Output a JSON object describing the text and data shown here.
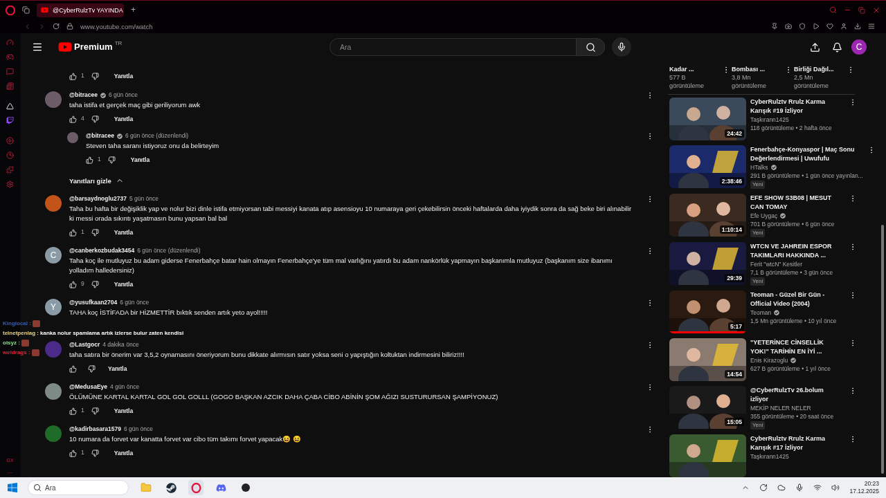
{
  "browser": {
    "tab": {
      "title": "@CyberRulzTv YAYINDA",
      "selected": true
    },
    "new_tab": "+",
    "url": "www.youtube.com/watch"
  },
  "opera_sidebar": {
    "badge": "GX",
    "more": "..."
  },
  "header": {
    "logo_text": "Premium",
    "region": "TR",
    "search": {
      "placeholder": "Ara"
    },
    "avatar": "C"
  },
  "comments": [
    {
      "kind": "actions",
      "likes": "1",
      "reply": "Yanıtla"
    },
    {
      "kind": "comment",
      "avatar": {
        "color": "#6d5c68"
      },
      "author": "@bitracee",
      "verified": true,
      "time": "6 gün önce",
      "text": "taha istifa et gerçek maç gibi geriliyorum awk",
      "likes": "4",
      "reply": "Yanıtla",
      "replies": [
        {
          "avatar": {
            "color": "#6d5c68"
          },
          "author": "@bitracee",
          "verified": true,
          "time": "6 gün önce (düzenlendi)",
          "text": "Steven taha saranı istiyoruz onu da belirteyim",
          "likes": "1",
          "reply": "Yanıtla"
        }
      ],
      "hide_replies": "Yanıtları gizle"
    },
    {
      "kind": "comment",
      "avatar": {
        "color": "#c2541a"
      },
      "author": "@barsaydnoglu2737",
      "verified": false,
      "time": "5 gün önce",
      "text": "Taha bu hafta bir değişiklik yap ve nolur bizi dinle istifa etmiyorsan tabi messiyi kanata atıp asensioyu 10 numaraya geri çekebilirsin önceki haftalarda daha iyiydik sonra da sağ beke biri alınabilir ki messi orada sıkıntı yaşatmasın bunu yapsan bal bal",
      "likes": "1",
      "reply": "Yanıtla"
    },
    {
      "kind": "comment",
      "avatar": {
        "color": "#8a9ba6",
        "letter": "C"
      },
      "author": "@canberkozbudak3454",
      "verified": false,
      "time": "6 gün önce (düzenlendi)",
      "text": "Taha koç ile mutluyuz bu adam giderse Fenerbahçe batar hain olmayın Fenerbahçe'ye tüm mal varlığını yatırdı bu adam nankörlük yapmayın başkanımla mutluyuz (başkanım size ibanımı yolladım halledersiniz)",
      "likes": "9",
      "reply": "Yanıtla"
    },
    {
      "kind": "comment",
      "avatar": {
        "color": "#8a9ba6",
        "letter": "Y"
      },
      "author": "@yusufkaan2704",
      "verified": false,
      "time": "6 gün önce",
      "text": "TAHA koç İSTİFADA bir HİZMETTİR  bıktık senden artık yeto ayol!!!!!"
    },
    {
      "kind": "comment",
      "avatar": {
        "color": "#4b2a8a"
      },
      "author": "@Lastgocr",
      "verified": false,
      "time": "4 dakika önce",
      "text": "taha satıra bir önerim var 3,5,2 oynamasını öneriyorum bunu dikkate alırmısın satır yoksa seni o yapıştığın koltuktan indirmesini biliriz!!!!",
      "reply": "Yanıtla"
    },
    {
      "kind": "comment",
      "avatar": {
        "color": "#7d8a86"
      },
      "author": "@MedusaEye",
      "verified": false,
      "time": "4 gün önce",
      "text": "ÖLÜMÜNE KARTAL KARTAL GOL GOL GOLLL (GOGO BAŞKAN AZCIK DAHA ÇABA CİBO ABİNİN ŞOM AĞIZI SUSTURURSAN ŞAMPİYONUZ)",
      "likes": "1",
      "reply": "Yanıtla"
    },
    {
      "kind": "comment",
      "avatar": {
        "color": "#1f6b2a"
      },
      "author": "@kadirbasara1579",
      "verified": false,
      "time": "6 gün önce",
      "text": "10 numara da forvet var kanatta forvet var cibo tüm takımı forvet yapacak😆 😆",
      "likes": "1",
      "reply": "Yanıtla"
    }
  ],
  "chat_overlay": [
    {
      "name": "Kinglocal :",
      "color": "#3a5fa8",
      "emote": true
    },
    {
      "name": "telnetpenlag :",
      "color": "#e8d48a",
      "message": "kanka nolur spamlama artık izlerse bulur zaten kendisi",
      "emote": false
    },
    {
      "name": "oisyz :",
      "color": "#8fe08a",
      "emote": true
    },
    {
      "name": "weldrags :",
      "color": "#d8283a",
      "emote": true
    }
  ],
  "top_videos": [
    {
      "title": "Kadar ...",
      "views": "577 B",
      "views_unit": "görüntüleme"
    },
    {
      "title": "Bombası ...",
      "views": "3,8 Mn",
      "views_unit": "görüntüleme"
    },
    {
      "title": "Birliği Dağıl...",
      "views": "2,5 Mn",
      "views_unit": "görüntüleme"
    }
  ],
  "videos": [
    {
      "title": "CyberRulztv Rrulz Karma Karışık #19 İzliyor",
      "channel": "Taşkırann1425",
      "verified": false,
      "meta": "118 görüntüleme • 2 hafta önce",
      "duration": "24:42"
    },
    {
      "title": "Fenerbahçe-Konyaspor | Maç Sonu Değerlendirmesi | Uwufufu",
      "channel": "HTalks",
      "verified": true,
      "meta": "291 B görüntüleme • 1 gün önce yayınlan...",
      "duration": "2:38:46",
      "badge": "Yeni"
    },
    {
      "title": "EFE SHOW S3B08 | MESUT CAN TOMAY",
      "channel": "Efe Uygaç",
      "verified": true,
      "meta": "701 B görüntüleme • 6 gün önce",
      "duration": "1:10:14",
      "badge": "Yeni"
    },
    {
      "title": "WTCN VE JAHREIN ESPOR TAKIMLARI HAKKINDA ...",
      "channel": "Ferit \"wtcN\" Kesitler",
      "verified": false,
      "meta": "7,1 B görüntüleme • 3 gün önce",
      "duration": "29:39",
      "badge": "Yeni"
    },
    {
      "title": "Teoman - Güzel Bir Gün - Official Video (2004)",
      "channel": "Teoman",
      "verified": true,
      "meta": "1,5 Mn görüntüleme • 10 yıl önce",
      "duration": "5:17",
      "level": 1
    },
    {
      "title": "\"YETERİNCE CİNSELLİK YOK!\" TARİHİN EN İYİ ...",
      "channel": "Enis Kirazoglu",
      "verified": true,
      "meta": "627 B görüntüleme • 1 yıl önce",
      "duration": "14:54"
    },
    {
      "title": "@CyberRulzTv  26.bolum izliyor",
      "channel": "MEKİP NELER NELER",
      "verified": false,
      "meta": "355 görüntüleme • 20 saat önce",
      "duration": "15:05",
      "badge": "Yeni"
    },
    {
      "title": "CyberRulztv Rrulz Karma Karışık #17 İzliyor",
      "channel": "Taşkırann1425",
      "verified": false
    }
  ],
  "taskbar": {
    "search": {
      "placeholder": "Ara"
    },
    "time": "20:23",
    "date": "17.12.2025"
  }
}
